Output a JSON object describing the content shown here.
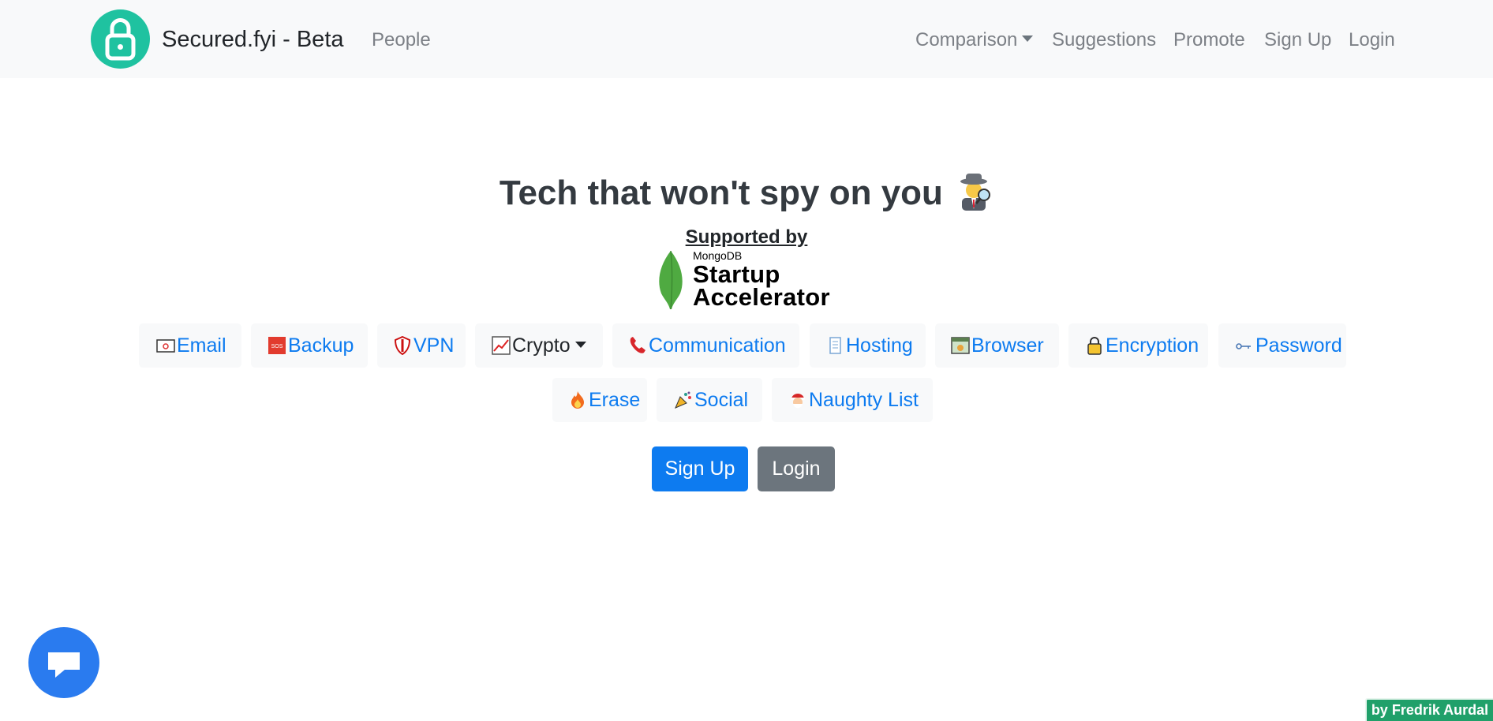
{
  "navbar": {
    "brand": "Secured.fyi - Beta",
    "links": {
      "people": "People",
      "comparison": "Comparison",
      "suggestions": "Suggestions",
      "promote": "Promote",
      "signup": "Sign Up",
      "login": "Login"
    }
  },
  "hero": {
    "headline": "Tech that won't spy on you",
    "headline_emoji": "detective-icon",
    "supported_by": "Supported by",
    "sponsor": {
      "small": "MongoDB",
      "line1": "Startup",
      "line2": "Accelerator"
    }
  },
  "categories": [
    {
      "label": "Email",
      "icon": "envelope-icon"
    },
    {
      "label": "Backup",
      "icon": "sos-icon"
    },
    {
      "label": "VPN",
      "icon": "shield-icon"
    },
    {
      "label": "Crypto",
      "icon": "chart-up-icon"
    },
    {
      "label": "Communication",
      "icon": "telephone-icon"
    },
    {
      "label": "Hosting",
      "icon": "page-icon"
    },
    {
      "label": "Browser",
      "icon": "browser-icon"
    },
    {
      "label": "Encryption",
      "icon": "lock-icon"
    },
    {
      "label": "Password",
      "icon": "key-icon"
    },
    {
      "label": "Erase",
      "icon": "fire-icon"
    },
    {
      "label": "Social",
      "icon": "party-popper-icon"
    },
    {
      "label": "Naughty List",
      "icon": "santa-icon"
    }
  ],
  "cta": {
    "signup": "Sign Up",
    "login": "Login"
  },
  "chat": {
    "icon": "chat-bubble-icon"
  },
  "credit": "by Fredrik Aurdal",
  "colors": {
    "brand": "#1fc2a0",
    "link": "#0d7bf0",
    "primary": "#0d7bf0",
    "secondary": "#6c757d",
    "chat": "#2a7bef",
    "credit": "#20a06a"
  }
}
